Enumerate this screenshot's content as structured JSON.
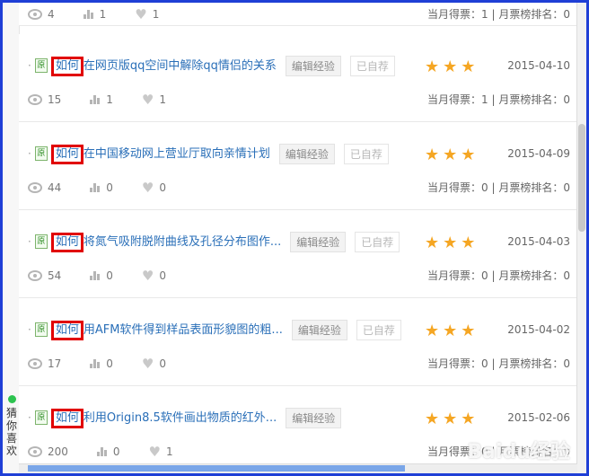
{
  "stat_labels": {
    "votes_prefix": "当月得票：",
    "rank_prefix": "| 月票榜排名："
  },
  "first_row": {
    "views": "4",
    "bars": "1",
    "likes": "1",
    "votes": "当月得票：1 | 月票榜排名：0"
  },
  "rows": [
    {
      "badge": "原",
      "prefix": "如何",
      "title": "在网页版qq空间中解除qq情侣的关系",
      "tag1": "编辑经验",
      "tag2": "已自荐",
      "stars": "★★★",
      "date": "2015-04-10",
      "views": "15",
      "bars": "1",
      "likes": "1",
      "votes": "当月得票：1 | 月票榜排名：0"
    },
    {
      "badge": "原",
      "prefix": "如何",
      "title": "在中国移动网上营业厅取向亲情计划",
      "tag1": "编辑经验",
      "tag2": "已自荐",
      "stars": "★★★",
      "date": "2015-04-09",
      "views": "44",
      "bars": "0",
      "likes": "0",
      "votes": "当月得票：0 | 月票榜排名：0"
    },
    {
      "badge": "原",
      "prefix": "如何",
      "title": "将氮气吸附脱附曲线及孔径分布图作...",
      "tag1": "编辑经验",
      "tag2": "已自荐",
      "stars": "★★★",
      "date": "2015-04-03",
      "views": "54",
      "bars": "0",
      "likes": "0",
      "votes": "当月得票：0 | 月票榜排名：0"
    },
    {
      "badge": "原",
      "prefix": "如何",
      "title": "用AFM软件得到样品表面形貌图的粗...",
      "tag1": "编辑经验",
      "tag2": "已自荐",
      "stars": "★★★",
      "date": "2015-04-02",
      "views": "17",
      "bars": "0",
      "likes": "0",
      "votes": "当月得票：0 | 月票榜排名：0"
    },
    {
      "badge": "原",
      "prefix": "如何",
      "title": "利用Origin8.5软件画出物质的红外...",
      "tag1": "编辑经验",
      "tag2": "",
      "stars": "★★★",
      "date": "2015-02-06",
      "views": "200",
      "bars": "0",
      "likes": "1",
      "votes": "当月得票：0 | 月票榜排名：0"
    }
  ],
  "side_widget": {
    "label": "猜你喜欢"
  },
  "watermark": "Baidu经验",
  "colors": {
    "frame": "#1f3fd6",
    "highlight": "#e10000",
    "star": "#f5a623",
    "link": "#2a6fb8"
  }
}
